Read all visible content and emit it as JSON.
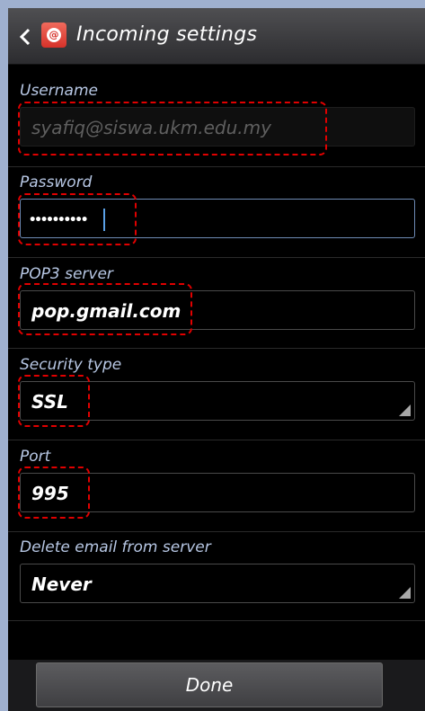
{
  "header": {
    "title": "Incoming settings"
  },
  "fields": {
    "username": {
      "label": "Username",
      "value": "syafiq@siswa.ukm.edu.my"
    },
    "password": {
      "label": "Password",
      "masked_value": "••••••••••"
    },
    "server": {
      "label": "POP3 server",
      "value": "pop.gmail.com"
    },
    "security": {
      "label": "Security type",
      "value": "SSL"
    },
    "port": {
      "label": "Port",
      "value": "995"
    },
    "delete": {
      "label": "Delete email from server",
      "value": "Never"
    }
  },
  "footer": {
    "done_label": "Done"
  },
  "colors": {
    "label": "#b7c7e4",
    "annotation": "#e00000",
    "background": "#000000"
  }
}
